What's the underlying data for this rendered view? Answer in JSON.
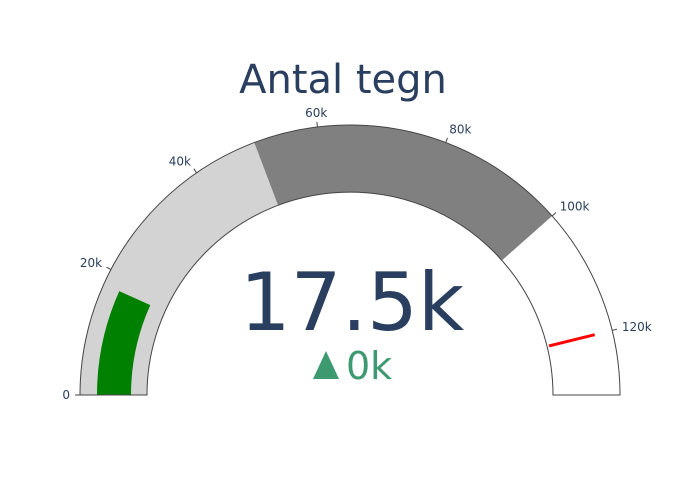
{
  "chart_data": {
    "type": "gauge",
    "title": "Antal tegn",
    "value": 17500,
    "value_label": "17.5k",
    "delta": {
      "reference": 17500,
      "label": "0k",
      "direction": "increasing",
      "color": "#3d9970"
    },
    "axis": {
      "range": [
        0,
        130000
      ],
      "ticks": [
        {
          "value": 0,
          "label": "0"
        },
        {
          "value": 20000,
          "label": "20k"
        },
        {
          "value": 40000,
          "label": "40k"
        },
        {
          "value": 60000,
          "label": "60k"
        },
        {
          "value": 80000,
          "label": "80k"
        },
        {
          "value": 100000,
          "label": "100k"
        },
        {
          "value": 120000,
          "label": "120k"
        }
      ]
    },
    "steps": [
      {
        "range": [
          0,
          50000
        ],
        "color": "#d3d3d3"
      },
      {
        "range": [
          50000,
          100000
        ],
        "color": "#808080"
      }
    ],
    "bar": {
      "color": "#008000"
    },
    "threshold": {
      "value": 120000,
      "color": "#ff0000"
    },
    "colors": {
      "text": "#2a3f5f",
      "background": "#ffffff",
      "border": "#444444"
    }
  }
}
